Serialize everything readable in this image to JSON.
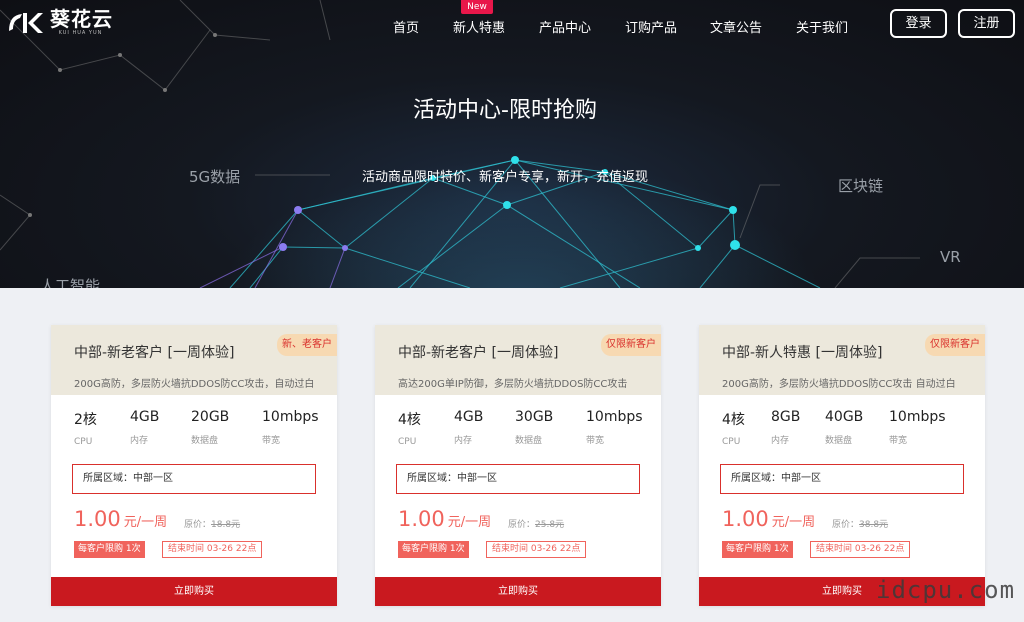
{
  "brand": {
    "name": "葵花云",
    "sub": "KUI HUA YUN"
  },
  "nav": {
    "items": [
      "首页",
      "新人特惠",
      "产品中心",
      "订购产品",
      "文章公告",
      "关于我们"
    ],
    "new_badge": "New",
    "login": "登录",
    "register": "注册"
  },
  "hero": {
    "title": "活动中心-限时抢购",
    "subtitle": "活动商品限时特价、新客户专享，新开，充值返现",
    "tags": [
      "5G数据",
      "区块链",
      "VR",
      "人工智能"
    ]
  },
  "cards": [
    {
      "title": "中部-新老客户 [一周体验]",
      "tag": "新、老客户",
      "desc": "200G高防，多层防火墙抗DDOS防CC攻击，自动过白",
      "specs": [
        {
          "value": "2核",
          "label": "CPU"
        },
        {
          "value": "4GB",
          "label": "内存"
        },
        {
          "value": "20GB",
          "label": "数据盘"
        },
        {
          "value": "10mbps",
          "label": "带宽"
        }
      ],
      "region_label": "所属区域：",
      "region_value": "中部一区",
      "price": "1.00",
      "unit": "元/一周",
      "orig_label": "原价：",
      "orig_value": "18.8元",
      "limit": "每客户限购 1次",
      "end_time": "结束时间 03-26 22点",
      "buy": "立即购买"
    },
    {
      "title": "中部-新老客户 [一周体验]",
      "tag": "仅限新客户",
      "desc": "高达200G单IP防御，多层防火墙抗DDOS防CC攻击",
      "specs": [
        {
          "value": "4核",
          "label": "CPU"
        },
        {
          "value": "4GB",
          "label": "内存"
        },
        {
          "value": "30GB",
          "label": "数据盘"
        },
        {
          "value": "10mbps",
          "label": "带宽"
        }
      ],
      "region_label": "所属区域：",
      "region_value": "中部一区",
      "price": "1.00",
      "unit": "元/一周",
      "orig_label": "原价：",
      "orig_value": "25.8元",
      "limit": "每客户限购 1次",
      "end_time": "结束时间 03-26 22点",
      "buy": "立即购买"
    },
    {
      "title": "中部-新人特惠 [一周体验]",
      "tag": "仅限新客户",
      "desc": "200G高防，多层防火墙抗DDOS防CC攻击 自动过白",
      "specs": [
        {
          "value": "4核",
          "label": "CPU"
        },
        {
          "value": "8GB",
          "label": "内存"
        },
        {
          "value": "40GB",
          "label": "数据盘"
        },
        {
          "value": "10mbps",
          "label": "带宽"
        }
      ],
      "region_label": "所属区域：",
      "region_value": "中部一区",
      "price": "1.00",
      "unit": "元/一周",
      "orig_label": "原价：",
      "orig_value": "38.8元",
      "limit": "每客户限购 1次",
      "end_time": "结束时间 03-26 22点",
      "buy": "立即购买"
    }
  ],
  "watermark": "idcpu.com",
  "colors": {
    "accent_red": "#c9191f",
    "price_red": "#f0635c",
    "tag_bg": "#f7d9b2",
    "card_head": "#ece8dc",
    "badge_pink": "#e8174a"
  }
}
